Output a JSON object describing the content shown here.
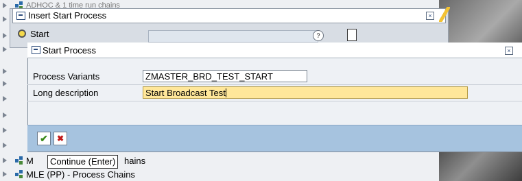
{
  "background_tree": {
    "items": [
      {
        "label": "ADHOC & 1 time run chains"
      },
      {
        "label": "M"
      },
      {
        "label": "hains"
      },
      {
        "label": "MLE (PP) - Process Chains"
      }
    ]
  },
  "outer_dialog": {
    "title": "Insert Start Process",
    "start_label": "Start"
  },
  "inner_dialog": {
    "title": "Start Process",
    "fields": [
      {
        "label": "Process Variants",
        "value": "ZMASTER_BRD_TEST_START"
      },
      {
        "label": "Long description",
        "value": "Start Broadcast Test"
      }
    ]
  },
  "tooltip": {
    "text": "Continue   (Enter)"
  },
  "icons": {
    "ok": "checkmark-icon",
    "cancel": "x-icon",
    "close": "close-icon",
    "help": "help-icon",
    "doc": "document-icon"
  },
  "colors": {
    "footer": "#a6c3df",
    "highlight_field": "#ffe79a"
  }
}
